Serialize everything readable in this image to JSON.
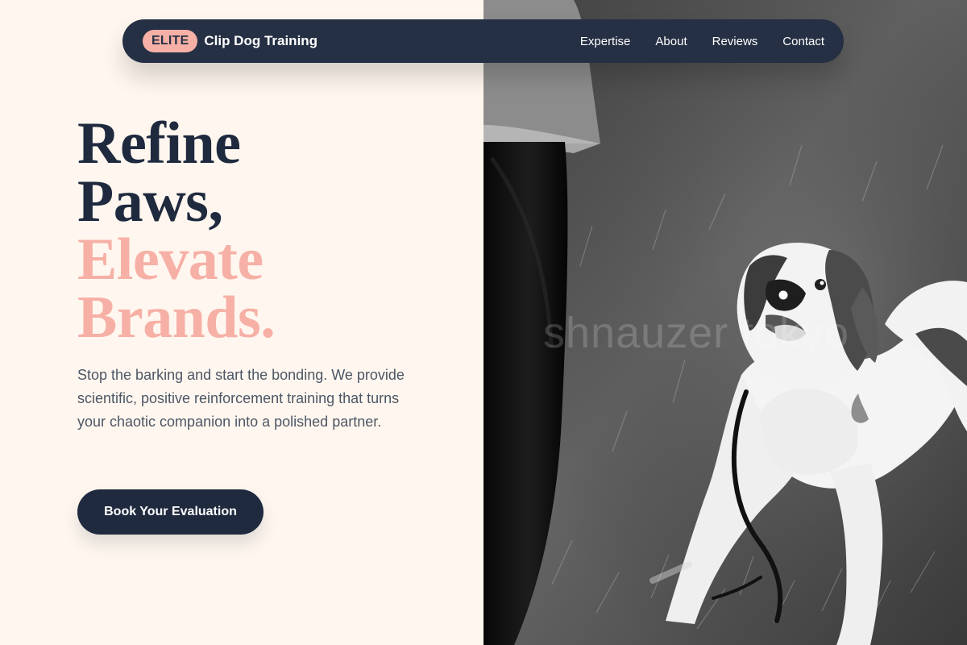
{
  "branding": {
    "badge": "ELITE",
    "name": "Clip Dog Training"
  },
  "nav": {
    "links": [
      {
        "label": "Expertise"
      },
      {
        "label": "About"
      },
      {
        "label": "Reviews"
      },
      {
        "label": "Contact"
      }
    ]
  },
  "hero": {
    "headline": {
      "line1": "Refine",
      "line2": "Paws,",
      "line3": "Elevate",
      "line4": "Brands."
    },
    "copy": "Stop the barking and start the bonding. We provide scientific, positive reinforcement training that turns your chaotic companion into a polished partner.",
    "cta_label": "Book Your Evaluation"
  },
  "image": {
    "watermark": "shnauzer tokyo"
  },
  "colors": {
    "navy": "#1f2a3f",
    "nav_bg": "#253044",
    "accent": "#f7b0a6",
    "background": "#fff7ef",
    "body_text": "#4d5665"
  }
}
